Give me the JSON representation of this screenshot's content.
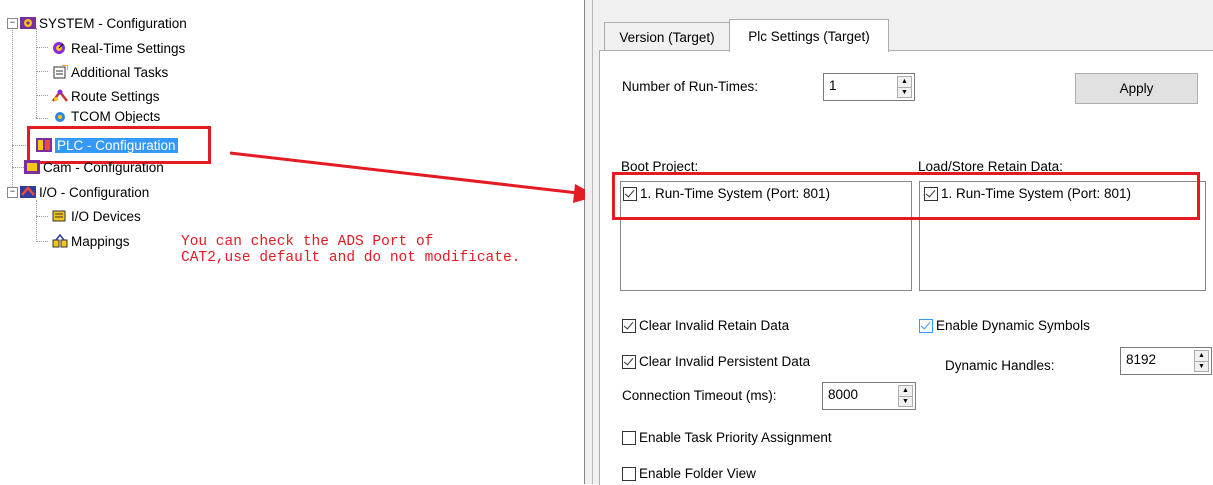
{
  "tree": {
    "root": "SYSTEM - Configuration",
    "system_children": [
      "Real-Time Settings",
      "Additional Tasks",
      "Route Settings",
      "TCOM Objects"
    ],
    "plc": "PLC - Configuration",
    "cam": "Cam - Configuration",
    "io": "I/O - Configuration",
    "io_children": [
      "I/O Devices",
      "Mappings"
    ]
  },
  "annotation": {
    "note": "You can check the ADS Port of\nCAT2,use default and do not modificate.",
    "color": "#e31b23"
  },
  "tabs": [
    {
      "label": "Version (Target)",
      "active": false
    },
    {
      "label": "Plc Settings (Target)",
      "active": true
    }
  ],
  "settings": {
    "runtimes_label": "Number of Run-Times:",
    "runtimes_value": "1",
    "apply_label": "Apply",
    "boot_project_label": "Boot Project:",
    "boot_project_item": "1. Run-Time System (Port: 801)",
    "retain_label": "Load/Store Retain Data:",
    "retain_item": "1. Run-Time System (Port: 801)",
    "clear_retain": "Clear Invalid Retain Data",
    "clear_persistent": "Clear Invalid Persistent Data",
    "timeout_label": "Connection Timeout (ms):",
    "timeout_value": "8000",
    "task_priority": "Enable Task Priority Assignment",
    "folder_view": "Enable Folder View",
    "dynamic_symbols": "Enable Dynamic Symbols",
    "dynamic_handles_label": "Dynamic Handles:",
    "dynamic_handles_value": "8192"
  },
  "checkbox_state": {
    "boot_project_item": true,
    "retain_item": true,
    "clear_retain": true,
    "clear_persistent": true,
    "task_priority": false,
    "folder_view": false,
    "dynamic_symbols": true
  },
  "icons": [
    "system-config-icon",
    "realtime-icon",
    "tasks-icon",
    "route-icon",
    "tcom-icon",
    "plc-icon",
    "cam-icon",
    "io-icon",
    "io-devices-icon",
    "mappings-icon",
    "arrow-icon"
  ]
}
